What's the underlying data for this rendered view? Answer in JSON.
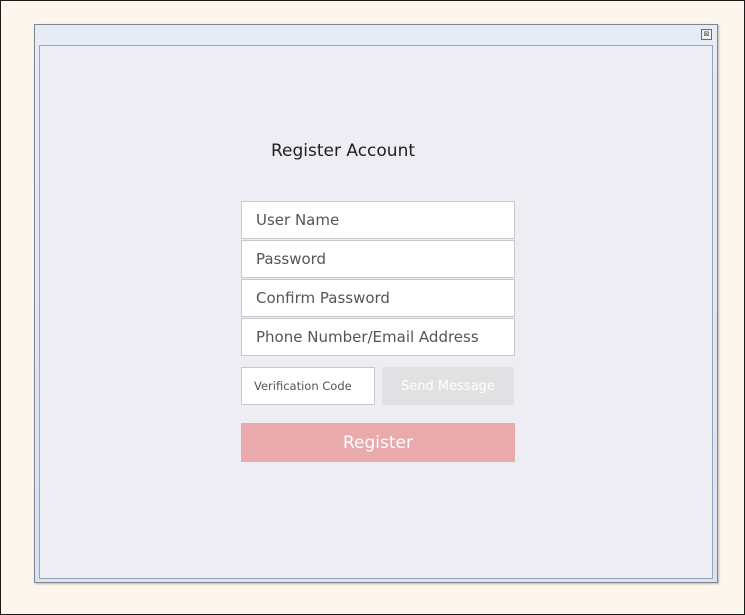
{
  "window": {
    "close_glyph": "⊠"
  },
  "form": {
    "title": "Register Account",
    "fields": [
      {
        "placeholder": "User Name"
      },
      {
        "placeholder": "Password"
      },
      {
        "placeholder": "Confirm Password"
      },
      {
        "placeholder": "Phone Number/Email Address"
      }
    ],
    "verification": {
      "placeholder": "Verification Code",
      "send_label": "Send Message"
    },
    "register_label": "Register"
  },
  "colors": {
    "register_button": "#e8aaab",
    "send_button_disabled": "#e1e1e4",
    "client_background": "#eeedf4",
    "outer_background": "#fcf6ec"
  }
}
